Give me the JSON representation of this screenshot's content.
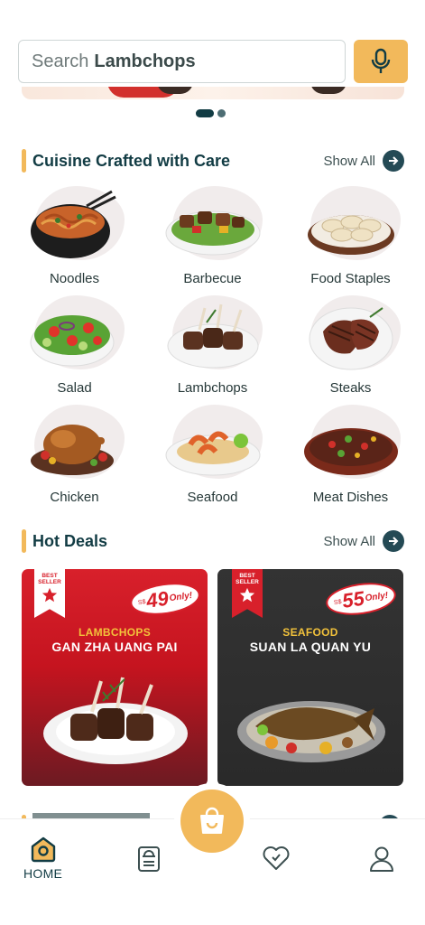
{
  "search": {
    "prefix": "Search",
    "term": "Lambchops"
  },
  "banner": {
    "page_count": 2,
    "active_page": 1
  },
  "cuisine": {
    "title": "Cuisine Crafted with Care",
    "show_all": "Show All",
    "items": [
      {
        "label": "Noodles",
        "icon": "noodles-bowl"
      },
      {
        "label": "Barbecue",
        "icon": "bbq-platter"
      },
      {
        "label": "Food Staples",
        "icon": "dumplings-plate"
      },
      {
        "label": "Salad",
        "icon": "salad-bowl"
      },
      {
        "label": "Lambchops",
        "icon": "lambchops-plate"
      },
      {
        "label": "Steaks",
        "icon": "steak-plate"
      },
      {
        "label": "Chicken",
        "icon": "roast-chicken"
      },
      {
        "label": "Seafood",
        "icon": "shrimp-plate"
      },
      {
        "label": "Meat Dishes",
        "icon": "meat-dish"
      }
    ]
  },
  "hot_deals": {
    "title": "Hot Deals",
    "show_all": "Show All",
    "cards": [
      {
        "badge_line1": "BEST",
        "badge_line2": "SELLER",
        "currency": "S$",
        "price": "49",
        "price_suffix": "Only!",
        "category": "LAMBCHOPS",
        "dish": "GAN ZHA UANG PAI",
        "theme": "#d8202b"
      },
      {
        "badge_line1": "BEST",
        "badge_line2": "SELLER",
        "currency": "S$",
        "price": "55",
        "price_suffix": "Only!",
        "category": "SEAFOOD",
        "dish": "SUAN LA QUAN YU",
        "theme": "#2e2e2e"
      }
    ]
  },
  "nav": {
    "home": "HOME",
    "active": "home",
    "accent": "#f2b95b"
  }
}
